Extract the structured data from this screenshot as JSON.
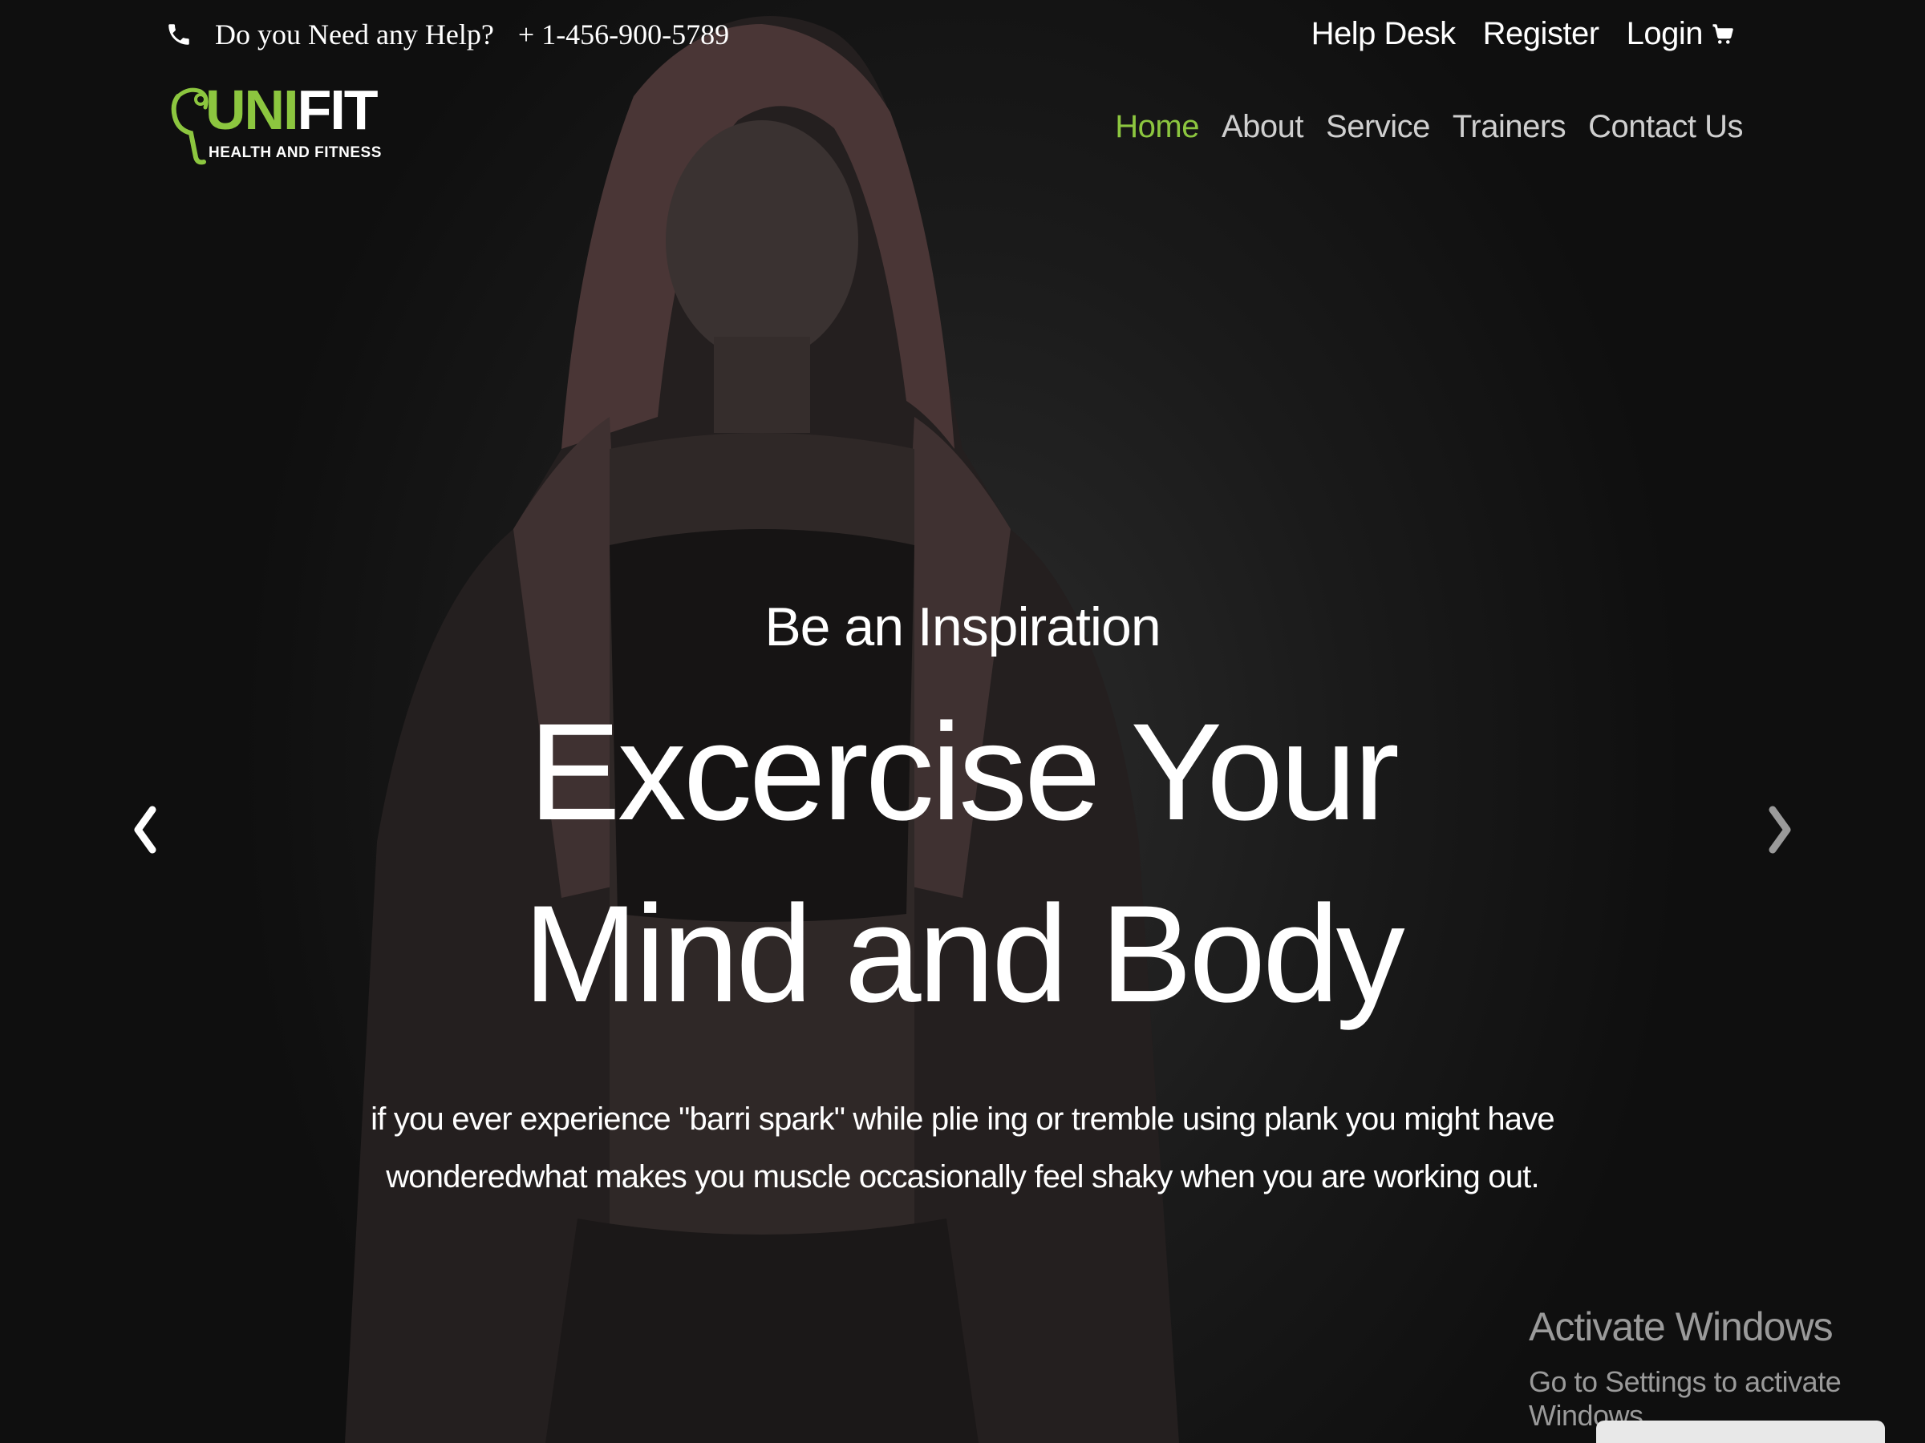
{
  "topbar": {
    "help_question": "Do you Need any Help?",
    "help_phone": "+ 1-456-900-5789",
    "links": {
      "help_desk": "Help Desk",
      "register": "Register",
      "login": "Login"
    }
  },
  "logo": {
    "title_part1": "UNI",
    "title_part2": "FIT",
    "subtitle": "HEALTH AND FITNESS"
  },
  "nav": {
    "items": [
      {
        "label": "Home",
        "active": true
      },
      {
        "label": "About",
        "active": false
      },
      {
        "label": "Service",
        "active": false
      },
      {
        "label": "Trainers",
        "active": false
      },
      {
        "label": "Contact Us",
        "active": false
      }
    ]
  },
  "hero": {
    "eyebrow": "Be an Inspiration",
    "headline": "Excercise Your Mind and Body",
    "description": "if you ever experience \"barri spark\" while plie ing or tremble using plank you might have wonderedwhat makes you muscle occasionally feel shaky when you are working out."
  },
  "icons": {
    "phone": "phone-icon",
    "cart": "cart-icon",
    "prev": "chevron-left-icon",
    "next": "chevron-right-icon"
  },
  "watermark": {
    "title": "Activate Windows",
    "subtitle": "Go to Settings to activate Windows."
  },
  "colors": {
    "accent": "#8cc63f",
    "background": "#121212",
    "nav_inactive": "#cfcfcf",
    "watermark": "#9a9a9a"
  }
}
